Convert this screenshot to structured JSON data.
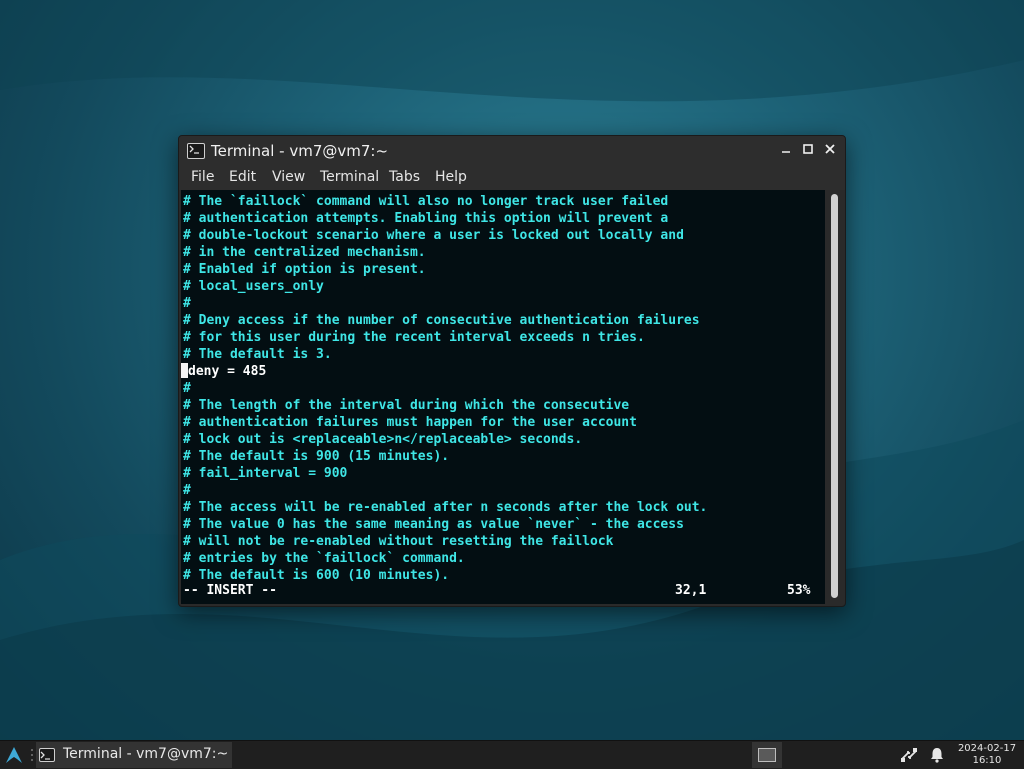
{
  "window": {
    "title": "Terminal - vm7@vm7:~",
    "controls": {
      "minimize": "—",
      "maximize": "□",
      "close": "✕"
    }
  },
  "menu": [
    "File",
    "Edit",
    "View",
    "Terminal",
    "Tabs",
    "Help"
  ],
  "terminal": {
    "lines": [
      "# The `faillock` command will also no longer track user failed",
      "# authentication attempts. Enabling this option will prevent a",
      "# double-lockout scenario where a user is locked out locally and",
      "# in the centralized mechanism.",
      "# Enabled if option is present.",
      "# local_users_only",
      "#",
      "# Deny access if the number of consecutive authentication failures",
      "# for this user during the recent interval exceeds n tries.",
      "# The default is 3.",
      "deny = 485",
      "#",
      "# The length of the interval during which the consecutive",
      "# authentication failures must happen for the user account",
      "# lock out is <replaceable>n</replaceable> seconds.",
      "# The default is 900 (15 minutes).",
      "# fail_interval = 900",
      "#",
      "# The access will be re-enabled after n seconds after the lock out.",
      "# The value 0 has the same meaning as value `never` - the access",
      "# will not be re-enabled without resetting the faillock",
      "# entries by the `faillock` command.",
      "# The default is 600 (10 minutes)."
    ],
    "status": {
      "mode": "-- INSERT --",
      "position": "32,1",
      "percent": "53%"
    }
  },
  "taskbar": {
    "task_label": "Terminal - vm7@vm7:~",
    "date": "2024-02-17",
    "time": "16:10"
  }
}
